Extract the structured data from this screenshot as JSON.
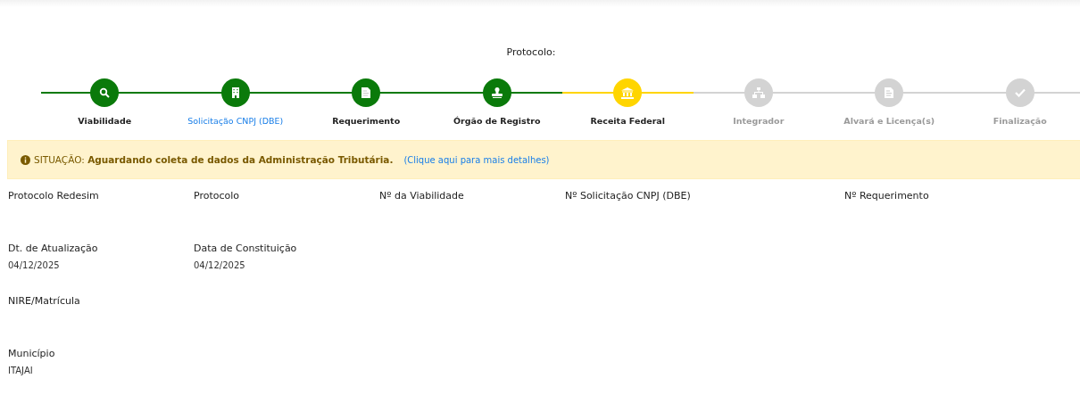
{
  "protocol_label": "Protocolo:",
  "steps": [
    {
      "label": "Viabilidade",
      "done": true,
      "current": false,
      "selected": false
    },
    {
      "label": "Solicitação CNPJ (DBE)",
      "done": true,
      "current": false,
      "selected": true
    },
    {
      "label": "Requerimento",
      "done": true,
      "current": false,
      "selected": false
    },
    {
      "label": "Órgão de Registro",
      "done": true,
      "current": false,
      "selected": false
    },
    {
      "label": "Receita Federal",
      "done": false,
      "current": true,
      "selected": false
    },
    {
      "label": "Integrador",
      "done": false,
      "current": false,
      "selected": false
    },
    {
      "label": "Alvará e Licença(s)",
      "done": false,
      "current": false,
      "selected": false
    },
    {
      "label": "Finalização",
      "done": false,
      "current": false,
      "selected": false
    }
  ],
  "alert": {
    "prefix": "SITUAÇÃO:",
    "message": "Aguardando coleta de dados da Administração Tributária.",
    "link": "(Clique aqui para mais detalhes)"
  },
  "field_rows": [
    [
      {
        "label": "Protocolo Redesim"
      },
      {
        "label": "Protocolo"
      },
      {
        "label": "Nº da Viabilidade"
      },
      {
        "label": "Nº Solicitação CNPJ (DBE)"
      },
      {
        "label": "Nº Requerimento"
      }
    ],
    [
      {
        "label": "Dt. de Atualização",
        "value": "04/12/2025"
      },
      {
        "label": "Data de Constituição",
        "value": "04/12/2025"
      }
    ],
    [
      {
        "label": "NIRE/Matrícula"
      }
    ],
    [
      {
        "label": "Município",
        "value": "ITAJAI"
      }
    ]
  ]
}
